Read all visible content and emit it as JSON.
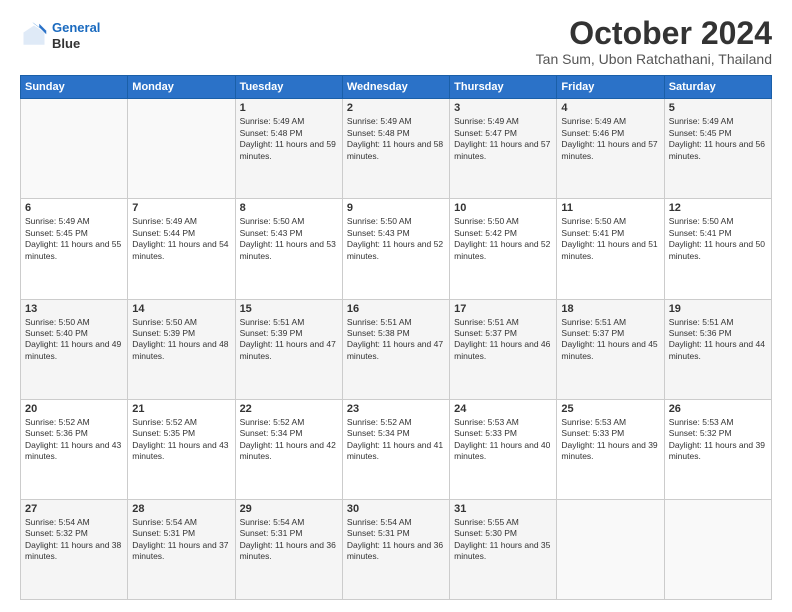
{
  "header": {
    "logo_line1": "General",
    "logo_line2": "Blue",
    "month": "October 2024",
    "location": "Tan Sum, Ubon Ratchathani, Thailand"
  },
  "weekdays": [
    "Sunday",
    "Monday",
    "Tuesday",
    "Wednesday",
    "Thursday",
    "Friday",
    "Saturday"
  ],
  "weeks": [
    [
      {
        "day": "",
        "sunrise": "",
        "sunset": "",
        "daylight": ""
      },
      {
        "day": "",
        "sunrise": "",
        "sunset": "",
        "daylight": ""
      },
      {
        "day": "1",
        "sunrise": "Sunrise: 5:49 AM",
        "sunset": "Sunset: 5:48 PM",
        "daylight": "Daylight: 11 hours and 59 minutes."
      },
      {
        "day": "2",
        "sunrise": "Sunrise: 5:49 AM",
        "sunset": "Sunset: 5:48 PM",
        "daylight": "Daylight: 11 hours and 58 minutes."
      },
      {
        "day": "3",
        "sunrise": "Sunrise: 5:49 AM",
        "sunset": "Sunset: 5:47 PM",
        "daylight": "Daylight: 11 hours and 57 minutes."
      },
      {
        "day": "4",
        "sunrise": "Sunrise: 5:49 AM",
        "sunset": "Sunset: 5:46 PM",
        "daylight": "Daylight: 11 hours and 57 minutes."
      },
      {
        "day": "5",
        "sunrise": "Sunrise: 5:49 AM",
        "sunset": "Sunset: 5:45 PM",
        "daylight": "Daylight: 11 hours and 56 minutes."
      }
    ],
    [
      {
        "day": "6",
        "sunrise": "Sunrise: 5:49 AM",
        "sunset": "Sunset: 5:45 PM",
        "daylight": "Daylight: 11 hours and 55 minutes."
      },
      {
        "day": "7",
        "sunrise": "Sunrise: 5:49 AM",
        "sunset": "Sunset: 5:44 PM",
        "daylight": "Daylight: 11 hours and 54 minutes."
      },
      {
        "day": "8",
        "sunrise": "Sunrise: 5:50 AM",
        "sunset": "Sunset: 5:43 PM",
        "daylight": "Daylight: 11 hours and 53 minutes."
      },
      {
        "day": "9",
        "sunrise": "Sunrise: 5:50 AM",
        "sunset": "Sunset: 5:43 PM",
        "daylight": "Daylight: 11 hours and 52 minutes."
      },
      {
        "day": "10",
        "sunrise": "Sunrise: 5:50 AM",
        "sunset": "Sunset: 5:42 PM",
        "daylight": "Daylight: 11 hours and 52 minutes."
      },
      {
        "day": "11",
        "sunrise": "Sunrise: 5:50 AM",
        "sunset": "Sunset: 5:41 PM",
        "daylight": "Daylight: 11 hours and 51 minutes."
      },
      {
        "day": "12",
        "sunrise": "Sunrise: 5:50 AM",
        "sunset": "Sunset: 5:41 PM",
        "daylight": "Daylight: 11 hours and 50 minutes."
      }
    ],
    [
      {
        "day": "13",
        "sunrise": "Sunrise: 5:50 AM",
        "sunset": "Sunset: 5:40 PM",
        "daylight": "Daylight: 11 hours and 49 minutes."
      },
      {
        "day": "14",
        "sunrise": "Sunrise: 5:50 AM",
        "sunset": "Sunset: 5:39 PM",
        "daylight": "Daylight: 11 hours and 48 minutes."
      },
      {
        "day": "15",
        "sunrise": "Sunrise: 5:51 AM",
        "sunset": "Sunset: 5:39 PM",
        "daylight": "Daylight: 11 hours and 47 minutes."
      },
      {
        "day": "16",
        "sunrise": "Sunrise: 5:51 AM",
        "sunset": "Sunset: 5:38 PM",
        "daylight": "Daylight: 11 hours and 47 minutes."
      },
      {
        "day": "17",
        "sunrise": "Sunrise: 5:51 AM",
        "sunset": "Sunset: 5:37 PM",
        "daylight": "Daylight: 11 hours and 46 minutes."
      },
      {
        "day": "18",
        "sunrise": "Sunrise: 5:51 AM",
        "sunset": "Sunset: 5:37 PM",
        "daylight": "Daylight: 11 hours and 45 minutes."
      },
      {
        "day": "19",
        "sunrise": "Sunrise: 5:51 AM",
        "sunset": "Sunset: 5:36 PM",
        "daylight": "Daylight: 11 hours and 44 minutes."
      }
    ],
    [
      {
        "day": "20",
        "sunrise": "Sunrise: 5:52 AM",
        "sunset": "Sunset: 5:36 PM",
        "daylight": "Daylight: 11 hours and 43 minutes."
      },
      {
        "day": "21",
        "sunrise": "Sunrise: 5:52 AM",
        "sunset": "Sunset: 5:35 PM",
        "daylight": "Daylight: 11 hours and 43 minutes."
      },
      {
        "day": "22",
        "sunrise": "Sunrise: 5:52 AM",
        "sunset": "Sunset: 5:34 PM",
        "daylight": "Daylight: 11 hours and 42 minutes."
      },
      {
        "day": "23",
        "sunrise": "Sunrise: 5:52 AM",
        "sunset": "Sunset: 5:34 PM",
        "daylight": "Daylight: 11 hours and 41 minutes."
      },
      {
        "day": "24",
        "sunrise": "Sunrise: 5:53 AM",
        "sunset": "Sunset: 5:33 PM",
        "daylight": "Daylight: 11 hours and 40 minutes."
      },
      {
        "day": "25",
        "sunrise": "Sunrise: 5:53 AM",
        "sunset": "Sunset: 5:33 PM",
        "daylight": "Daylight: 11 hours and 39 minutes."
      },
      {
        "day": "26",
        "sunrise": "Sunrise: 5:53 AM",
        "sunset": "Sunset: 5:32 PM",
        "daylight": "Daylight: 11 hours and 39 minutes."
      }
    ],
    [
      {
        "day": "27",
        "sunrise": "Sunrise: 5:54 AM",
        "sunset": "Sunset: 5:32 PM",
        "daylight": "Daylight: 11 hours and 38 minutes."
      },
      {
        "day": "28",
        "sunrise": "Sunrise: 5:54 AM",
        "sunset": "Sunset: 5:31 PM",
        "daylight": "Daylight: 11 hours and 37 minutes."
      },
      {
        "day": "29",
        "sunrise": "Sunrise: 5:54 AM",
        "sunset": "Sunset: 5:31 PM",
        "daylight": "Daylight: 11 hours and 36 minutes."
      },
      {
        "day": "30",
        "sunrise": "Sunrise: 5:54 AM",
        "sunset": "Sunset: 5:31 PM",
        "daylight": "Daylight: 11 hours and 36 minutes."
      },
      {
        "day": "31",
        "sunrise": "Sunrise: 5:55 AM",
        "sunset": "Sunset: 5:30 PM",
        "daylight": "Daylight: 11 hours and 35 minutes."
      },
      {
        "day": "",
        "sunrise": "",
        "sunset": "",
        "daylight": ""
      },
      {
        "day": "",
        "sunrise": "",
        "sunset": "",
        "daylight": ""
      }
    ]
  ]
}
